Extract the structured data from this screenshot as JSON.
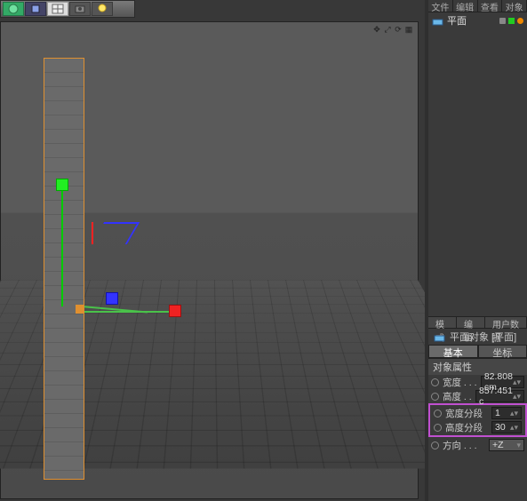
{
  "top_tabs": {
    "file": "文件",
    "edit": "编辑",
    "view": "查看",
    "objects": "对象"
  },
  "object_manager": {
    "obj_name": "平面"
  },
  "attr": {
    "tabs": {
      "mode": "模式",
      "edit": "编辑",
      "userdata": "用户数据"
    },
    "title": "平面对象 [平面]",
    "tabs2": {
      "basic": "基本",
      "coord": "坐标"
    },
    "section": "对象属性",
    "width_label": "宽度 . . .",
    "width_val": "82.808 cm",
    "height_label": "高度 . .",
    "height_val": "857.451 c",
    "wseg_label": "宽度分段",
    "wseg_val": "1",
    "hseg_label": "高度分段",
    "hseg_val": "30",
    "orient_label": "方向 . . .",
    "orient_val": "+Z"
  }
}
